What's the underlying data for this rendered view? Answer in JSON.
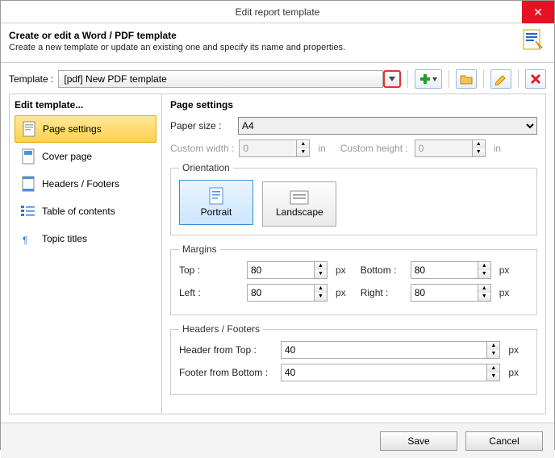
{
  "window": {
    "title": "Edit report template"
  },
  "header": {
    "title": "Create or edit a Word / PDF template",
    "subtitle": "Create a new template or update an existing one and specify its name and properties."
  },
  "template_row": {
    "label": "Template :",
    "selected": "[pdf] New PDF template"
  },
  "sidebar": {
    "title": "Edit template...",
    "items": [
      {
        "label": "Page settings",
        "active": true
      },
      {
        "label": "Cover page"
      },
      {
        "label": "Headers / Footers"
      },
      {
        "label": "Table of contents"
      },
      {
        "label": "Topic titles"
      }
    ]
  },
  "page_settings": {
    "title": "Page settings",
    "paper_size_label": "Paper size :",
    "paper_size_value": "A4",
    "custom_width_label": "Custom width :",
    "custom_width_value": "0",
    "custom_height_label": "Custom height :",
    "custom_height_value": "0",
    "size_unit": "in",
    "orientation": {
      "legend": "Orientation",
      "portrait": "Portrait",
      "landscape": "Landscape",
      "selected": "portrait"
    },
    "margins": {
      "legend": "Margins",
      "top_label": "Top :",
      "top": "80",
      "bottom_label": "Bottom :",
      "bottom": "80",
      "left_label": "Left :",
      "left": "80",
      "right_label": "Right :",
      "right": "80",
      "unit": "px"
    },
    "hf": {
      "legend": "Headers / Footers",
      "header_label": "Header from Top :",
      "header": "40",
      "footer_label": "Footer from Bottom :",
      "footer": "40",
      "unit": "px"
    }
  },
  "footer": {
    "save": "Save",
    "cancel": "Cancel"
  }
}
